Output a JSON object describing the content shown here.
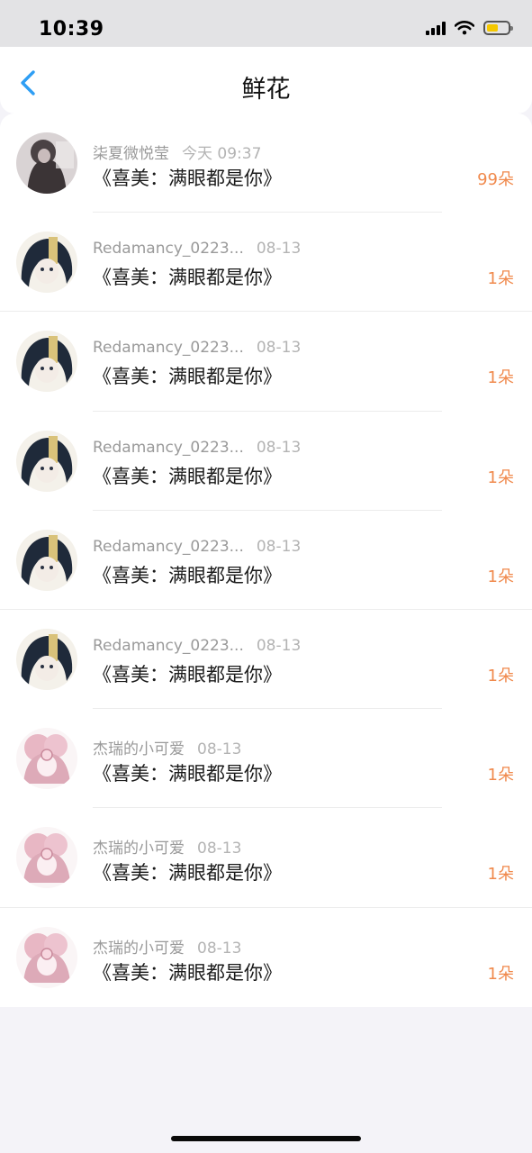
{
  "status": {
    "time": "10:39"
  },
  "nav": {
    "title": "鲜花"
  },
  "colors": {
    "accent": "#2e9ef4",
    "count": "#f0894c"
  },
  "items": [
    {
      "name": "柒夏微悦莹",
      "date": "今天 09:37",
      "gift": "《喜美：满眼都是你》",
      "count": "99朵",
      "avatar": "girl-photo"
    },
    {
      "name": "Redamancy_0223...",
      "date": "08-13",
      "gift": "《喜美：满眼都是你》",
      "count": "1朵",
      "avatar": "anime-dark"
    },
    {
      "name": "Redamancy_0223...",
      "date": "08-13",
      "gift": "《喜美：满眼都是你》",
      "count": "1朵",
      "avatar": "anime-dark"
    },
    {
      "name": "Redamancy_0223...",
      "date": "08-13",
      "gift": "《喜美：满眼都是你》",
      "count": "1朵",
      "avatar": "anime-dark"
    },
    {
      "name": "Redamancy_0223...",
      "date": "08-13",
      "gift": "《喜美：满眼都是你》",
      "count": "1朵",
      "avatar": "anime-dark"
    },
    {
      "name": "Redamancy_0223...",
      "date": "08-13",
      "gift": "《喜美：满眼都是你》",
      "count": "1朵",
      "avatar": "anime-dark"
    },
    {
      "name": "杰瑞的小可爱",
      "date": "08-13",
      "gift": "《喜美：满眼都是你》",
      "count": "1朵",
      "avatar": "anime-pink"
    },
    {
      "name": "杰瑞的小可爱",
      "date": "08-13",
      "gift": "《喜美：满眼都是你》",
      "count": "1朵",
      "avatar": "anime-pink"
    },
    {
      "name": "杰瑞的小可爱",
      "date": "08-13",
      "gift": "《喜美：满眼都是你》",
      "count": "1朵",
      "avatar": "anime-pink"
    }
  ]
}
